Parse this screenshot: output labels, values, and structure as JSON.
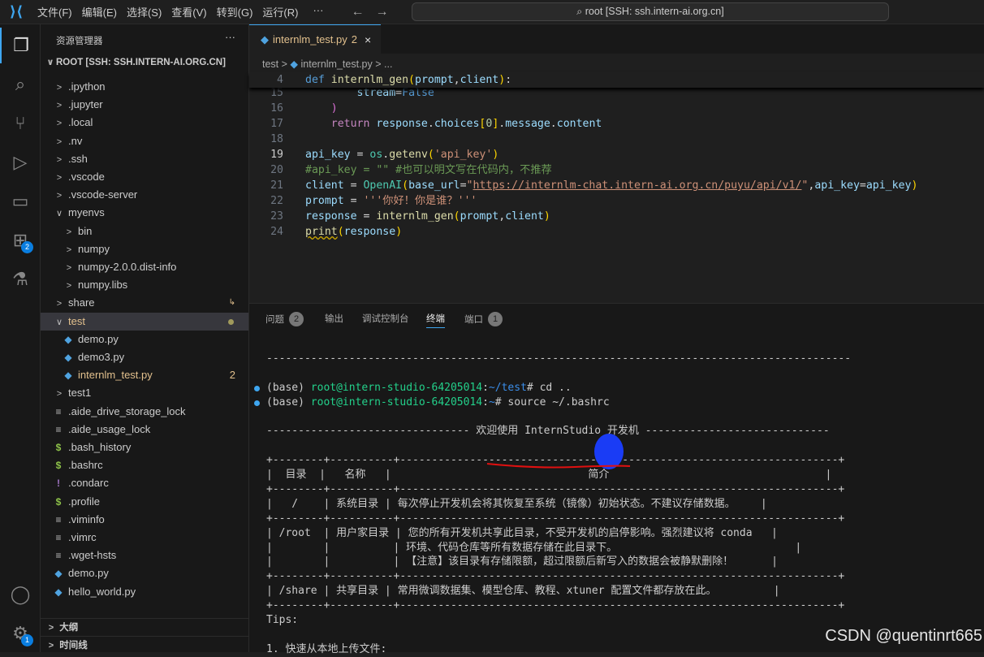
{
  "menu": [
    "文件(F)",
    "编辑(E)",
    "选择(S)",
    "查看(V)",
    "转到(G)",
    "运行(R)",
    "···"
  ],
  "command_center": "⌕ root [SSH: ssh.intern-ai.org.cn]",
  "activity_badges": {
    "extensions": "2",
    "settings": "1"
  },
  "sidebar": {
    "title": "资源管理器",
    "more": "···",
    "root": "ROOT [SSH: SSH.INTERN-AI.ORG.CN]",
    "items": [
      {
        "label": ".ipython",
        "type": "folder",
        "depth": 0
      },
      {
        "label": ".jupyter",
        "type": "folder",
        "depth": 0
      },
      {
        "label": ".local",
        "type": "folder",
        "depth": 0
      },
      {
        "label": ".nv",
        "type": "folder",
        "depth": 0
      },
      {
        "label": ".ssh",
        "type": "folder",
        "depth": 0
      },
      {
        "label": ".vscode",
        "type": "folder",
        "depth": 0
      },
      {
        "label": ".vscode-server",
        "type": "folder",
        "depth": 0
      },
      {
        "label": "myenvs",
        "type": "folder-open",
        "depth": 0
      },
      {
        "label": "bin",
        "type": "folder",
        "depth": 1
      },
      {
        "label": "numpy",
        "type": "folder",
        "depth": 1
      },
      {
        "label": "numpy-2.0.0.dist-info",
        "type": "folder",
        "depth": 1
      },
      {
        "label": "numpy.libs",
        "type": "folder",
        "depth": 1
      },
      {
        "label": "share",
        "type": "folder",
        "depth": 0,
        "symlink": "↳"
      },
      {
        "label": "test",
        "type": "folder-open",
        "depth": 0,
        "selected": true,
        "modified": true
      },
      {
        "label": "demo.py",
        "type": "py",
        "depth": 1
      },
      {
        "label": "demo3.py",
        "type": "py",
        "depth": 1
      },
      {
        "label": "internlm_test.py",
        "type": "py",
        "depth": 1,
        "modified": true,
        "badge": "2"
      },
      {
        "label": "test1",
        "type": "folder",
        "depth": 0
      },
      {
        "label": ".aide_drive_storage_lock",
        "type": "txt",
        "depth": 0
      },
      {
        "label": ".aide_usage_lock",
        "type": "txt",
        "depth": 0
      },
      {
        "label": ".bash_history",
        "type": "sh",
        "depth": 0
      },
      {
        "label": ".bashrc",
        "type": "sh",
        "depth": 0
      },
      {
        "label": ".condarc",
        "type": "yml",
        "depth": 0
      },
      {
        "label": ".profile",
        "type": "sh",
        "depth": 0
      },
      {
        "label": ".viminfo",
        "type": "txt",
        "depth": 0
      },
      {
        "label": ".vimrc",
        "type": "txt",
        "depth": 0
      },
      {
        "label": ".wget-hsts",
        "type": "txt",
        "depth": 0
      },
      {
        "label": "demo.py",
        "type": "py",
        "depth": 0
      },
      {
        "label": "hello_world.py",
        "type": "py",
        "depth": 0
      }
    ],
    "sections": [
      "大纲",
      "时间线"
    ]
  },
  "editor": {
    "tab": {
      "label": "internlm_test.py",
      "problems": "2",
      "close": "×"
    },
    "breadcrumb": [
      "test",
      "internlm_test.py",
      "..."
    ],
    "lines": [
      {
        "n": "4",
        "sticky": true,
        "t": [
          [
            "kw",
            "def "
          ],
          [
            "fn",
            "internlm_gen"
          ],
          [
            "br",
            "("
          ],
          [
            "var",
            "prompt"
          ],
          [
            "pl",
            ","
          ],
          [
            "var",
            "client"
          ],
          [
            "br",
            ")"
          ],
          [
            "pl",
            ":"
          ]
        ]
      },
      {
        "n": "15",
        "t": [
          [
            "pl",
            "        "
          ],
          [
            "var",
            "stream"
          ],
          [
            "pl",
            "="
          ],
          [
            "kw",
            "False"
          ]
        ]
      },
      {
        "n": "16",
        "t": [
          [
            "pl",
            "    "
          ],
          [
            "br2",
            ")"
          ]
        ]
      },
      {
        "n": "17",
        "t": [
          [
            "pl",
            "    "
          ],
          [
            "ctl",
            "return "
          ],
          [
            "var",
            "response"
          ],
          [
            "pl",
            "."
          ],
          [
            "var",
            "choices"
          ],
          [
            "br",
            "["
          ],
          [
            "num",
            "0"
          ],
          [
            "br",
            "]"
          ],
          [
            "pl",
            "."
          ],
          [
            "var",
            "message"
          ],
          [
            "pl",
            "."
          ],
          [
            "var",
            "content"
          ]
        ]
      },
      {
        "n": "18",
        "t": []
      },
      {
        "n": "19",
        "cur": true,
        "t": [
          [
            "var",
            "api_key"
          ],
          [
            "pl",
            " = "
          ],
          [
            "cls",
            "os"
          ],
          [
            "pl",
            "."
          ],
          [
            "fn",
            "getenv"
          ],
          [
            "br",
            "("
          ],
          [
            "str",
            "'api_key'"
          ],
          [
            "br",
            ")"
          ]
        ]
      },
      {
        "n": "20",
        "t": [
          [
            "cm",
            "#api_key = \"\" #也可以明文写在代码内，不推荐"
          ]
        ]
      },
      {
        "n": "21",
        "t": [
          [
            "var",
            "client"
          ],
          [
            "pl",
            " = "
          ],
          [
            "cls",
            "OpenAI"
          ],
          [
            "br",
            "("
          ],
          [
            "var",
            "base_url"
          ],
          [
            "pl",
            "="
          ],
          [
            "str",
            "\""
          ],
          [
            "str url",
            "https://internlm-chat.intern-ai.org.cn/puyu/api/v1/"
          ],
          [
            "str",
            "\""
          ],
          [
            "pl",
            ","
          ],
          [
            "var",
            "api_key"
          ],
          [
            "pl",
            "="
          ],
          [
            "var",
            "api_key"
          ],
          [
            "br",
            ")"
          ]
        ]
      },
      {
        "n": "22",
        "t": [
          [
            "var",
            "prompt"
          ],
          [
            "pl",
            " = "
          ],
          [
            "str",
            "'''你好！你是谁？'''"
          ]
        ]
      },
      {
        "n": "23",
        "t": [
          [
            "var",
            "response"
          ],
          [
            "pl",
            " = "
          ],
          [
            "fn",
            "internlm_gen"
          ],
          [
            "br",
            "("
          ],
          [
            "var",
            "prompt"
          ],
          [
            "pl",
            ","
          ],
          [
            "var",
            "client"
          ],
          [
            "br",
            ")"
          ]
        ]
      },
      {
        "n": "24",
        "t": [
          [
            "fn squig",
            "print"
          ],
          [
            "br",
            "("
          ],
          [
            "var",
            "response"
          ],
          [
            "br",
            ")"
          ]
        ]
      }
    ]
  },
  "panel": {
    "tabs": [
      {
        "label": "问题",
        "badge": "2"
      },
      {
        "label": "输出"
      },
      {
        "label": "调试控制台"
      },
      {
        "label": "终端",
        "active": true
      },
      {
        "label": "端口",
        "badge": "1"
      }
    ],
    "terminal": [
      {
        "t": [
          [
            "",
            "--------------------------------------------------------------------------------------------"
          ]
        ]
      },
      {
        "t": []
      },
      {
        "dot": true,
        "t": [
          [
            "",
            "(base) "
          ],
          [
            "tg",
            "root@intern-studio-64205014"
          ],
          [
            "",
            ":"
          ],
          [
            "tb",
            "~/test"
          ],
          [
            "",
            "# cd .."
          ]
        ]
      },
      {
        "dot": true,
        "t": [
          [
            "",
            "(base) "
          ],
          [
            "tg",
            "root@intern-studio-64205014"
          ],
          [
            "",
            ":"
          ],
          [
            "tb",
            "~"
          ],
          [
            "",
            "# source ~/.bashrc"
          ]
        ]
      },
      {
        "t": []
      },
      {
        "t": [
          [
            "",
            "-------------------------------- 欢迎使用 InternStudio 开发机 -----------------------------"
          ]
        ]
      },
      {
        "t": []
      },
      {
        "t": [
          [
            "",
            "+--------+----------+---------------------------------------------------------------------+"
          ]
        ]
      },
      {
        "t": [
          [
            "",
            "|  目录  |   名称   |                               简介                                  |"
          ]
        ]
      },
      {
        "t": [
          [
            "",
            "+--------+----------+---------------------------------------------------------------------+"
          ]
        ]
      },
      {
        "t": [
          [
            "",
            "|   /    | 系统目录 | 每次停止开发机会将其恢复至系统（镜像）初始状态。不建议存储数据。    |"
          ]
        ]
      },
      {
        "t": [
          [
            "",
            "+--------+----------+---------------------------------------------------------------------+"
          ]
        ]
      },
      {
        "t": [
          [
            "",
            "| /root  | 用户家目录 | 您的所有开发机共享此目录，不受开发机的启停影响。强烈建议将 conda   |"
          ]
        ]
      },
      {
        "t": [
          [
            "",
            "|        |          | 环境、代码仓库等所有数据存储在此目录下。                            |"
          ]
        ]
      },
      {
        "t": [
          [
            "",
            "|        |          | 【注意】该目录有存储限额，超过限额后新写入的数据会被静默删除！      |"
          ]
        ]
      },
      {
        "t": [
          [
            "",
            "+--------+----------+---------------------------------------------------------------------+"
          ]
        ]
      },
      {
        "t": [
          [
            "",
            "| /share | 共享目录 | 常用微调数据集、模型仓库、教程、xtuner 配置文件都存放在此。         |"
          ]
        ]
      },
      {
        "t": [
          [
            "",
            "+--------+----------+---------------------------------------------------------------------+"
          ]
        ]
      },
      {
        "t": [
          [
            "",
            "Tips:"
          ]
        ]
      },
      {
        "t": []
      },
      {
        "t": [
          [
            "",
            "1. 快速从本地上传文件:"
          ]
        ]
      }
    ]
  },
  "watermark": "CSDN @quentinrt665",
  "colors": {
    "accent": "#3ea6f0",
    "modified": "#e2c08d",
    "terminal_green": "#23d18b",
    "annotation_red": "#e01010",
    "cursor_highlight": "#1a3cf5"
  }
}
